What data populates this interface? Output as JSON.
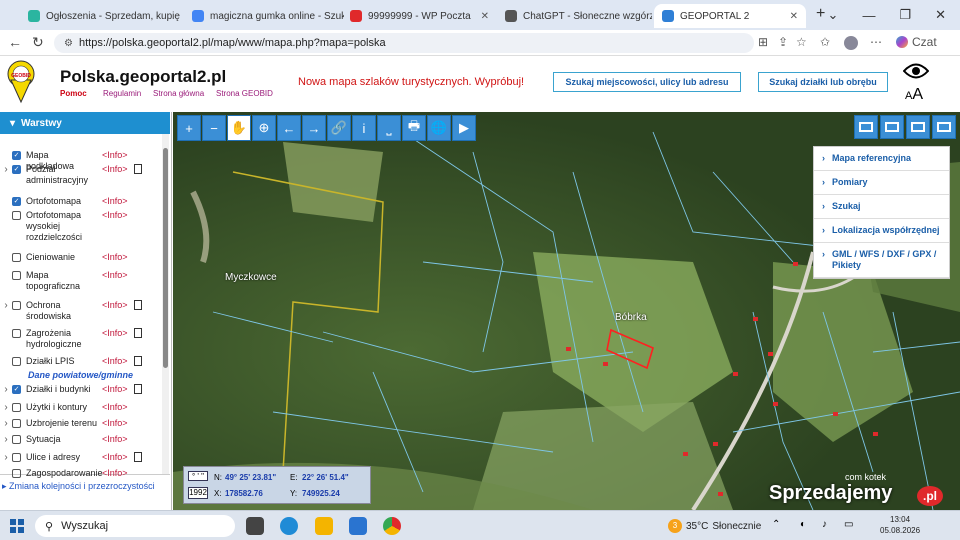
{
  "browser": {
    "tabs": [
      {
        "label": "Ogłoszenia - Sprzedam, kupię",
        "color": "#2bb5a0"
      },
      {
        "label": "magiczna gumka online - Szuk",
        "color": "#4285f4"
      },
      {
        "label": "99999999 - WP Poczta",
        "color": "#e0292b"
      },
      {
        "label": "ChatGPT - Słoneczne wzgórza",
        "color": "#555555"
      },
      {
        "label": "GEOPORTAL 2",
        "color": "#2f7fd6"
      }
    ],
    "new_tab": "+",
    "window_controls": [
      "⌄",
      "—",
      "❐",
      "✕"
    ],
    "url": "https://polska.geoportal2.pl/map/www/mapa.php?mapa=polska",
    "chat_label": "Czat"
  },
  "header": {
    "logo_text": "GEOBID",
    "title": "Polska.geoportal2.pl",
    "links": [
      "Pomoc",
      "Regulamin",
      "Strona główna",
      "Strona GEOBID"
    ],
    "promo": "Nowa mapa szlaków turystycznych. Wypróbuj!",
    "btn_search_place": "Szukaj miejscowości, ulicy lub adresu",
    "btn_search_plot": "Szukaj działki lub obrębu",
    "font_size_a": "A",
    "font_size_big": "A"
  },
  "panel": {
    "title": "Warstwy",
    "info": "<Info>",
    "layers": [
      {
        "name": "Mapa podkładowa",
        "checked": true,
        "expand": false,
        "doc": false
      },
      {
        "name": "Podział administracyjny",
        "checked": true,
        "expand": true,
        "doc": true
      },
      {
        "name": "Ortofotomapa",
        "checked": true,
        "expand": false,
        "doc": false
      },
      {
        "name": "Ortofotomapa wysokiej rozdzielczości",
        "checked": false,
        "expand": false,
        "doc": false
      },
      {
        "name": "Cieniowanie",
        "checked": false,
        "expand": false,
        "doc": false
      },
      {
        "name": "Mapa topograficzna",
        "checked": false,
        "expand": false,
        "doc": false
      },
      {
        "name": "Ochrona środowiska",
        "checked": false,
        "expand": true,
        "doc": true
      },
      {
        "name": "Zagrożenia hydrologiczne",
        "checked": false,
        "expand": false,
        "doc": true
      },
      {
        "name": "Działki LPIS",
        "checked": false,
        "expand": false,
        "doc": true
      }
    ],
    "section_label": "Dane powiatowe/gminne",
    "local_layers": [
      {
        "name": "Działki i budynki",
        "checked": true,
        "expand": true,
        "doc": true
      },
      {
        "name": "Użytki i kontury",
        "checked": false,
        "expand": true,
        "doc": false
      },
      {
        "name": "Uzbrojenie terenu",
        "checked": false,
        "expand": true,
        "doc": false
      },
      {
        "name": "Sytuacja",
        "checked": false,
        "expand": true,
        "doc": false
      },
      {
        "name": "Ulice i adresy",
        "checked": false,
        "expand": true,
        "doc": true
      },
      {
        "name": "Zagospodarowanie",
        "checked": false,
        "expand": false,
        "doc": false
      }
    ],
    "footer": "Zmiana kolejności i przezroczystości"
  },
  "map": {
    "tools": [
      "zoom-in",
      "zoom-out",
      "pan",
      "zoom-box",
      "back",
      "forward",
      "link",
      "info",
      "measure",
      "print",
      "globe",
      "camera"
    ],
    "tool_glyphs": [
      "+",
      "−",
      "✋",
      "⊕",
      "←",
      "→",
      "🔗",
      "i",
      "⎵",
      "🖶",
      "🌐",
      "▶"
    ],
    "menu": [
      "Mapa referencyjna",
      "Pomiary",
      "Szukaj",
      "Lokalizacja współrzędnej",
      "GML / WFS / DXF / GPX / Pikiety"
    ],
    "places": [
      "Myczkowce",
      "Bóbrka"
    ],
    "coords": {
      "n_label": "N:",
      "n": "49° 25' 23.81\"",
      "e_label": "E:",
      "e": "22° 26' 51.4\"",
      "x_label": "X:",
      "x": "178582.76",
      "y_label": "Y:",
      "y": "749925.24",
      "system": "1992",
      "dms": "° ' \""
    },
    "attribution": "com kotek",
    "watermark": "Sprzedajemy",
    "watermark_pl": ".pl"
  },
  "taskbar": {
    "search": "Wyszukaj",
    "weather_temp": "35°C",
    "weather_desc": "Słonecznie",
    "badge": "3",
    "time": "13:04",
    "date": "05.08.2026"
  }
}
